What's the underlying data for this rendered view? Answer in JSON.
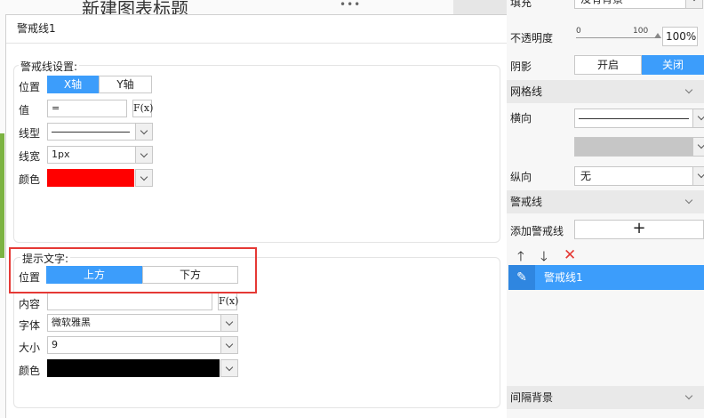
{
  "background": {
    "chart_title": "新建图表标题",
    "dots": "•••"
  },
  "dialog": {
    "title": "警戒线1",
    "warning_settings": {
      "section_title": "警戒线设置:",
      "position_label": "位置",
      "position_options": [
        "X轴",
        "Y轴"
      ],
      "position_selected": "X轴",
      "value_label": "值",
      "value": "=",
      "fx_label": "F(x)",
      "linetype_label": "线型",
      "linewidth_label": "线宽",
      "linewidth_value": "1px",
      "color_label": "颜色",
      "color_value": "#ff0000"
    },
    "hint_text": {
      "section_title": "提示文字:",
      "position_label": "位置",
      "position_options": [
        "上方",
        "下方"
      ],
      "position_selected": "上方",
      "content_label": "内容",
      "content_value": "",
      "fx_label": "F(x)",
      "font_label": "字体",
      "font_value": "微软雅黑",
      "size_label": "大小",
      "size_value": "9",
      "color_label": "颜色",
      "color_value": "#000000"
    }
  },
  "right_panel": {
    "fill_label": "填充",
    "fill_value": "没有背景",
    "opacity_label": "不透明度",
    "opacity_min": "0",
    "opacity_max": "100",
    "opacity_value": "100%",
    "shadow_label": "阴影",
    "shadow_options": [
      "开启",
      "关闭"
    ],
    "shadow_selected": "关闭",
    "grid_section": "网格线",
    "horizontal_label": "横向",
    "vertical_label": "纵向",
    "vertical_value": "无",
    "warning_section": "警戒线",
    "add_warning_label": "添加警戒线",
    "add_symbol": "+",
    "up_arrow": "🡑",
    "down_arrow": "🡓",
    "delete_symbol": "✕",
    "list_items": [
      "警戒线1"
    ],
    "interval_section": "间隔背景",
    "accent_color": "#3c9dfb",
    "delete_color": "#e53935"
  }
}
